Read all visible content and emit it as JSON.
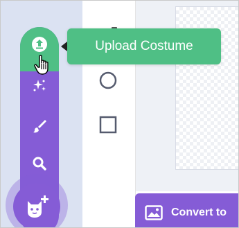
{
  "tooltip": {
    "label": "Upload Costume"
  },
  "convert_button": {
    "label": "Convert to"
  },
  "menu": {
    "items": [
      {
        "name": "upload-costume",
        "icon": "upload-icon"
      },
      {
        "name": "surprise",
        "icon": "sparkles-icon"
      },
      {
        "name": "paint",
        "icon": "paintbrush-icon"
      },
      {
        "name": "search",
        "icon": "search-icon"
      }
    ],
    "main_button_icon": "cat-plus-icon"
  },
  "tools": [
    {
      "name": "circle-tool",
      "icon": "circle-icon"
    },
    {
      "name": "rectangle-tool",
      "icon": "square-icon"
    }
  ],
  "colors": {
    "purple": "#855cd6",
    "green": "#4fbf85",
    "sidebar_blue": "#dbe2f2"
  }
}
